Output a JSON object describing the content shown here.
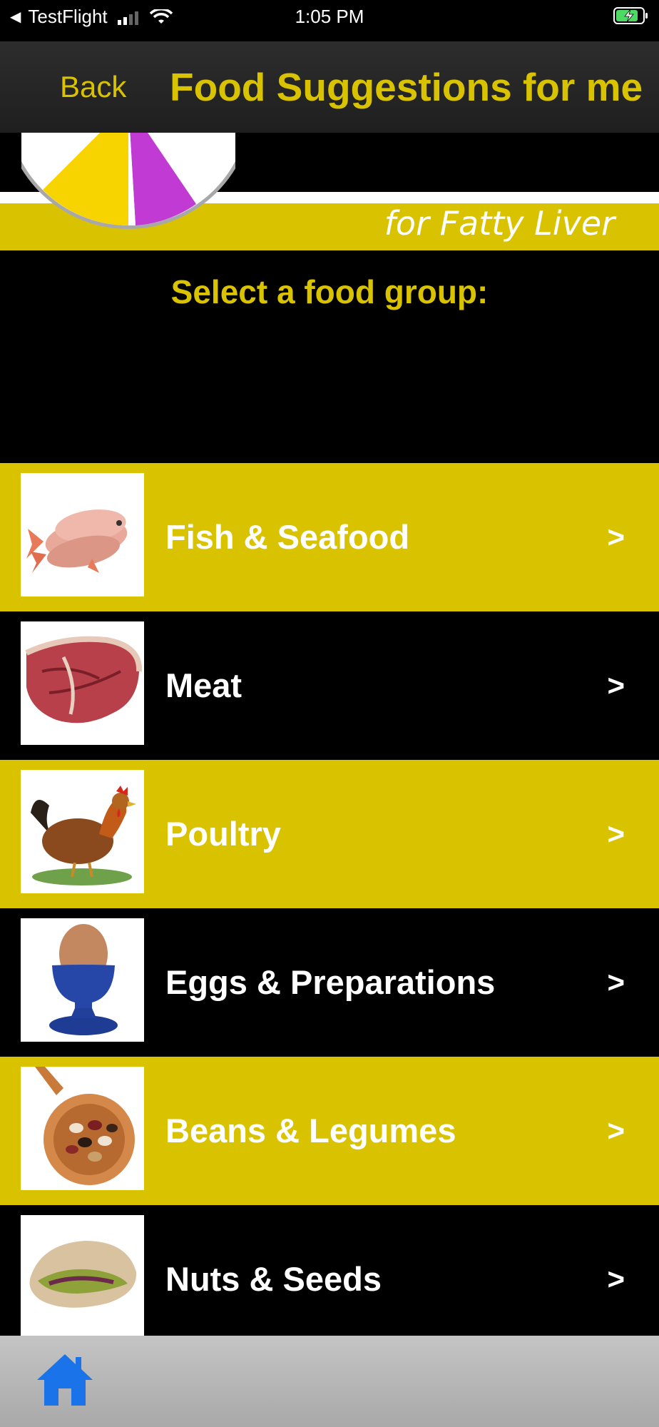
{
  "status_bar": {
    "back_app": "TestFlight",
    "time": "1:05 PM"
  },
  "nav": {
    "back_label": "Back",
    "title": "Food Suggestions for me"
  },
  "banner": {
    "subtitle": "for Fatty Liver"
  },
  "prompt": "Select a food group:",
  "food_groups": [
    {
      "label": "Fish & Seafood",
      "icon": "fish-image"
    },
    {
      "label": "Meat",
      "icon": "steak-image"
    },
    {
      "label": "Poultry",
      "icon": "rooster-image"
    },
    {
      "label": "Eggs & Preparations",
      "icon": "egg-cup-image"
    },
    {
      "label": "Beans & Legumes",
      "icon": "beans-spoon-image"
    },
    {
      "label": "Nuts & Seeds",
      "icon": "pistachio-image"
    }
  ],
  "chevron": ">",
  "colors": {
    "accent_yellow": "#d9c300",
    "background": "#000000",
    "home_blue": "#1a73e8"
  }
}
